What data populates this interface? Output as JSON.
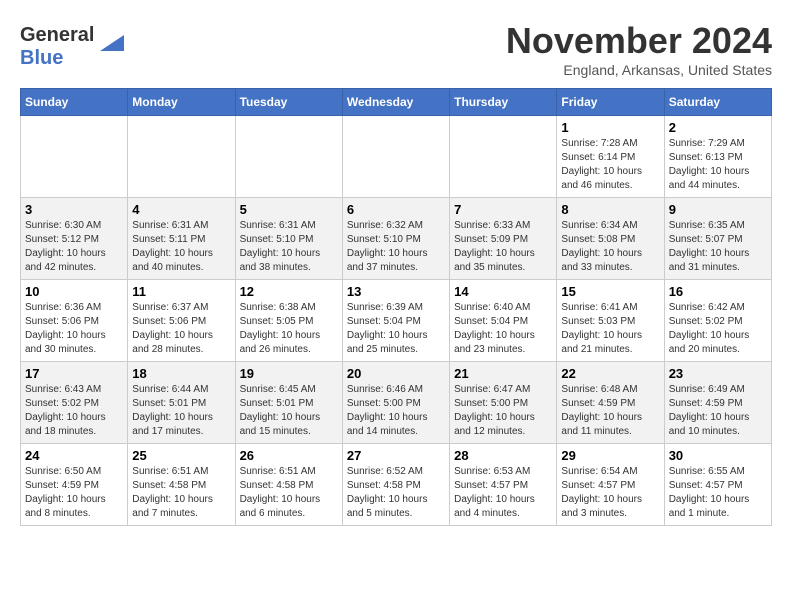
{
  "logo": {
    "line1": "General",
    "line2": "Blue"
  },
  "title": "November 2024",
  "subtitle": "England, Arkansas, United States",
  "weekdays": [
    "Sunday",
    "Monday",
    "Tuesday",
    "Wednesday",
    "Thursday",
    "Friday",
    "Saturday"
  ],
  "weeks": [
    [
      {
        "day": "",
        "info": ""
      },
      {
        "day": "",
        "info": ""
      },
      {
        "day": "",
        "info": ""
      },
      {
        "day": "",
        "info": ""
      },
      {
        "day": "",
        "info": ""
      },
      {
        "day": "1",
        "info": "Sunrise: 7:28 AM\nSunset: 6:14 PM\nDaylight: 10 hours and 46 minutes."
      },
      {
        "day": "2",
        "info": "Sunrise: 7:29 AM\nSunset: 6:13 PM\nDaylight: 10 hours and 44 minutes."
      }
    ],
    [
      {
        "day": "3",
        "info": "Sunrise: 6:30 AM\nSunset: 5:12 PM\nDaylight: 10 hours and 42 minutes."
      },
      {
        "day": "4",
        "info": "Sunrise: 6:31 AM\nSunset: 5:11 PM\nDaylight: 10 hours and 40 minutes."
      },
      {
        "day": "5",
        "info": "Sunrise: 6:31 AM\nSunset: 5:10 PM\nDaylight: 10 hours and 38 minutes."
      },
      {
        "day": "6",
        "info": "Sunrise: 6:32 AM\nSunset: 5:10 PM\nDaylight: 10 hours and 37 minutes."
      },
      {
        "day": "7",
        "info": "Sunrise: 6:33 AM\nSunset: 5:09 PM\nDaylight: 10 hours and 35 minutes."
      },
      {
        "day": "8",
        "info": "Sunrise: 6:34 AM\nSunset: 5:08 PM\nDaylight: 10 hours and 33 minutes."
      },
      {
        "day": "9",
        "info": "Sunrise: 6:35 AM\nSunset: 5:07 PM\nDaylight: 10 hours and 31 minutes."
      }
    ],
    [
      {
        "day": "10",
        "info": "Sunrise: 6:36 AM\nSunset: 5:06 PM\nDaylight: 10 hours and 30 minutes."
      },
      {
        "day": "11",
        "info": "Sunrise: 6:37 AM\nSunset: 5:06 PM\nDaylight: 10 hours and 28 minutes."
      },
      {
        "day": "12",
        "info": "Sunrise: 6:38 AM\nSunset: 5:05 PM\nDaylight: 10 hours and 26 minutes."
      },
      {
        "day": "13",
        "info": "Sunrise: 6:39 AM\nSunset: 5:04 PM\nDaylight: 10 hours and 25 minutes."
      },
      {
        "day": "14",
        "info": "Sunrise: 6:40 AM\nSunset: 5:04 PM\nDaylight: 10 hours and 23 minutes."
      },
      {
        "day": "15",
        "info": "Sunrise: 6:41 AM\nSunset: 5:03 PM\nDaylight: 10 hours and 21 minutes."
      },
      {
        "day": "16",
        "info": "Sunrise: 6:42 AM\nSunset: 5:02 PM\nDaylight: 10 hours and 20 minutes."
      }
    ],
    [
      {
        "day": "17",
        "info": "Sunrise: 6:43 AM\nSunset: 5:02 PM\nDaylight: 10 hours and 18 minutes."
      },
      {
        "day": "18",
        "info": "Sunrise: 6:44 AM\nSunset: 5:01 PM\nDaylight: 10 hours and 17 minutes."
      },
      {
        "day": "19",
        "info": "Sunrise: 6:45 AM\nSunset: 5:01 PM\nDaylight: 10 hours and 15 minutes."
      },
      {
        "day": "20",
        "info": "Sunrise: 6:46 AM\nSunset: 5:00 PM\nDaylight: 10 hours and 14 minutes."
      },
      {
        "day": "21",
        "info": "Sunrise: 6:47 AM\nSunset: 5:00 PM\nDaylight: 10 hours and 12 minutes."
      },
      {
        "day": "22",
        "info": "Sunrise: 6:48 AM\nSunset: 4:59 PM\nDaylight: 10 hours and 11 minutes."
      },
      {
        "day": "23",
        "info": "Sunrise: 6:49 AM\nSunset: 4:59 PM\nDaylight: 10 hours and 10 minutes."
      }
    ],
    [
      {
        "day": "24",
        "info": "Sunrise: 6:50 AM\nSunset: 4:59 PM\nDaylight: 10 hours and 8 minutes."
      },
      {
        "day": "25",
        "info": "Sunrise: 6:51 AM\nSunset: 4:58 PM\nDaylight: 10 hours and 7 minutes."
      },
      {
        "day": "26",
        "info": "Sunrise: 6:51 AM\nSunset: 4:58 PM\nDaylight: 10 hours and 6 minutes."
      },
      {
        "day": "27",
        "info": "Sunrise: 6:52 AM\nSunset: 4:58 PM\nDaylight: 10 hours and 5 minutes."
      },
      {
        "day": "28",
        "info": "Sunrise: 6:53 AM\nSunset: 4:57 PM\nDaylight: 10 hours and 4 minutes."
      },
      {
        "day": "29",
        "info": "Sunrise: 6:54 AM\nSunset: 4:57 PM\nDaylight: 10 hours and 3 minutes."
      },
      {
        "day": "30",
        "info": "Sunrise: 6:55 AM\nSunset: 4:57 PM\nDaylight: 10 hours and 1 minute."
      }
    ]
  ]
}
